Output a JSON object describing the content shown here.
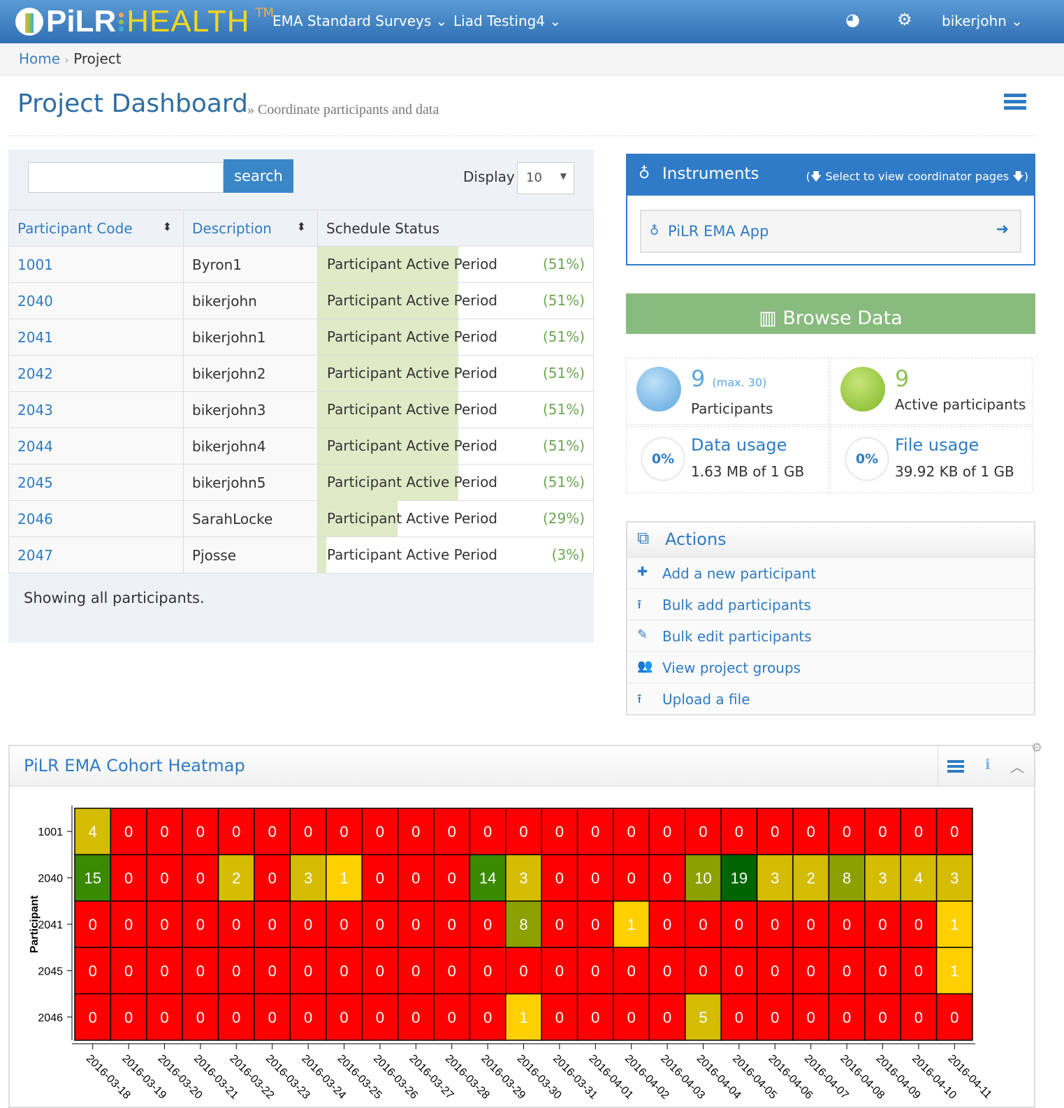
{
  "nav": {
    "logo_left": "PiLR",
    "logo_right": "HEALTH",
    "logo_tm": "TM",
    "menu1": "EMA Standard Surveys",
    "menu2": "Liad Testing4",
    "user": "bikerjohn",
    "dashboard_icon": "dashboard-icon",
    "settings_icon": "cogs-icon"
  },
  "breadcrumb": {
    "home": "Home",
    "current": "Project"
  },
  "page": {
    "title": "Project Dashboard",
    "subtitle": "» Coordinate participants and data"
  },
  "search": {
    "value": "",
    "button": "search",
    "display_label": "Display",
    "display_value": "10"
  },
  "table": {
    "headers": [
      "Participant Code",
      "Description",
      "Schedule Status"
    ],
    "rows": [
      {
        "code": "1001",
        "desc": "Byron1",
        "status": "Participant Active Period",
        "pct": "(51%)",
        "progress": 51
      },
      {
        "code": "2040",
        "desc": "bikerjohn",
        "status": "Participant Active Period",
        "pct": "(51%)",
        "progress": 51
      },
      {
        "code": "2041",
        "desc": "bikerjohn1",
        "status": "Participant Active Period",
        "pct": "(51%)",
        "progress": 51
      },
      {
        "code": "2042",
        "desc": "bikerjohn2",
        "status": "Participant Active Period",
        "pct": "(51%)",
        "progress": 51
      },
      {
        "code": "2043",
        "desc": "bikerjohn3",
        "status": "Participant Active Period",
        "pct": "(51%)",
        "progress": 51
      },
      {
        "code": "2044",
        "desc": "bikerjohn4",
        "status": "Participant Active Period",
        "pct": "(51%)",
        "progress": 51
      },
      {
        "code": "2045",
        "desc": "bikerjohn5",
        "status": "Participant Active Period",
        "pct": "(51%)",
        "progress": 51
      },
      {
        "code": "2046",
        "desc": "SarahLocke",
        "status": "Participant Active Period",
        "pct": "(29%)",
        "progress": 29
      },
      {
        "code": "2047",
        "desc": "Pjosse",
        "status": "Participant Active Period",
        "pct": "(3%)",
        "progress": 3
      }
    ],
    "footer": "Showing all participants."
  },
  "instruments": {
    "title": "Instruments",
    "hint": "(🡇 Select to view coordinator pages 🡇)",
    "items": [
      "PiLR EMA App"
    ]
  },
  "browse": "Browse Data",
  "stats": {
    "participants": "9",
    "max": "(max. 30)",
    "participants_label": "Participants",
    "active": "9",
    "active_label": "Active participants",
    "data_pct": "0%",
    "data_title": "Data usage",
    "data_value": "1.63 MB of 1 GB",
    "file_pct": "0%",
    "file_title": "File usage",
    "file_value": "39.92 KB of 1 GB"
  },
  "actions": {
    "title": "Actions",
    "items": [
      {
        "label": "Add a new participant",
        "icon": "plus-icon"
      },
      {
        "label": "Bulk add participants",
        "icon": "upload-icon"
      },
      {
        "label": "Bulk edit participants",
        "icon": "pencil-icon"
      },
      {
        "label": "View project groups",
        "icon": "users-icon"
      },
      {
        "label": "Upload a file",
        "icon": "upload-icon"
      }
    ]
  },
  "chart_data": {
    "type": "heatmap",
    "title": "PiLR EMA Cohort Heatmap",
    "ylabel": "Participant",
    "xlabel": "",
    "y": [
      "1001",
      "2040",
      "2041",
      "2045",
      "2046"
    ],
    "x": [
      "2016-03-18",
      "2016-03-19",
      "2016-03-20",
      "2016-03-21",
      "2016-03-22",
      "2016-03-23",
      "2016-03-24",
      "2016-03-25",
      "2016-03-26",
      "2016-03-27",
      "2016-03-28",
      "2016-03-29",
      "2016-03-30",
      "2016-03-31",
      "2016-04-01",
      "2016-04-02",
      "2016-04-03",
      "2016-04-04",
      "2016-04-05",
      "2016-04-06",
      "2016-04-07",
      "2016-04-08",
      "2016-04-09",
      "2016-04-10",
      "2016-04-11"
    ],
    "values": [
      [
        4,
        0,
        0,
        0,
        0,
        0,
        0,
        0,
        0,
        0,
        0,
        0,
        0,
        0,
        0,
        0,
        0,
        0,
        0,
        0,
        0,
        0,
        0,
        0,
        0
      ],
      [
        15,
        0,
        0,
        0,
        2,
        0,
        3,
        1,
        0,
        0,
        0,
        14,
        3,
        0,
        0,
        0,
        0,
        10,
        19,
        3,
        2,
        8,
        3,
        4,
        3
      ],
      [
        0,
        0,
        0,
        0,
        0,
        0,
        0,
        0,
        0,
        0,
        0,
        0,
        8,
        0,
        0,
        1,
        0,
        0,
        0,
        0,
        0,
        0,
        0,
        0,
        1
      ],
      [
        0,
        0,
        0,
        0,
        0,
        0,
        0,
        0,
        0,
        0,
        0,
        0,
        0,
        0,
        0,
        0,
        0,
        0,
        0,
        0,
        0,
        0,
        0,
        0,
        1
      ],
      [
        0,
        0,
        0,
        0,
        0,
        0,
        0,
        0,
        0,
        0,
        0,
        0,
        1,
        0,
        0,
        0,
        0,
        5,
        0,
        0,
        0,
        0,
        0,
        0,
        0
      ]
    ],
    "colors": {
      "0": "#ff0000",
      "1": "#ffd000",
      "low": "#d4bc00",
      "mid": "#8ca000",
      "high": "#3a8a00",
      "max": "#006400"
    }
  }
}
